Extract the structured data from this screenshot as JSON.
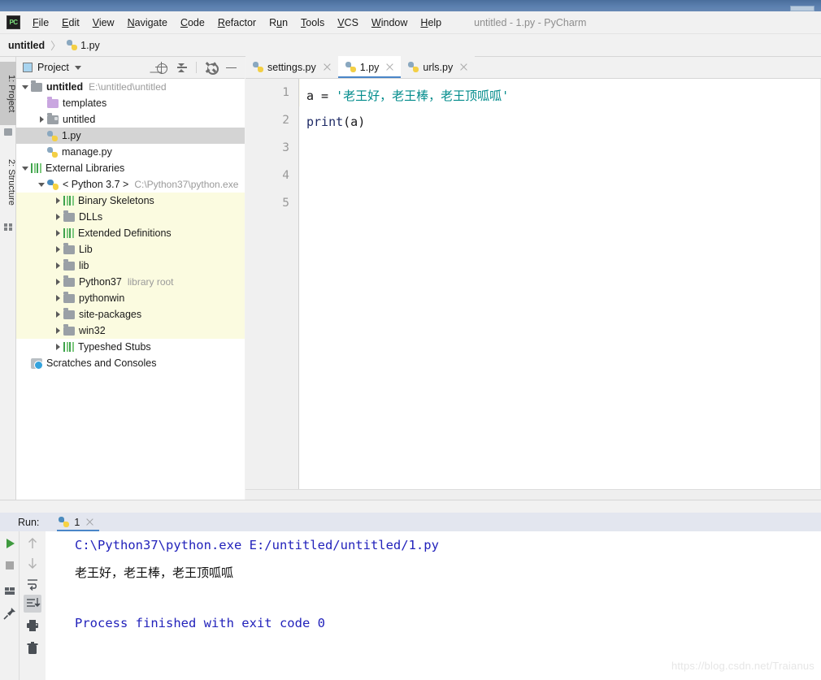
{
  "window": {
    "title": "untitled - 1.py - PyCharm",
    "minimize_icon": "window-minimize-icon"
  },
  "menubar": {
    "logo": "pycharm-logo-icon",
    "items": [
      {
        "label": "File",
        "mnemonic": "F"
      },
      {
        "label": "Edit",
        "mnemonic": "E"
      },
      {
        "label": "View",
        "mnemonic": "V"
      },
      {
        "label": "Navigate",
        "mnemonic": "N"
      },
      {
        "label": "Code",
        "mnemonic": "C"
      },
      {
        "label": "Refactor",
        "mnemonic": "R"
      },
      {
        "label": "Run",
        "mnemonic": "u"
      },
      {
        "label": "Tools",
        "mnemonic": "T"
      },
      {
        "label": "VCS",
        "mnemonic": "V"
      },
      {
        "label": "Window",
        "mnemonic": "W"
      },
      {
        "label": "Help",
        "mnemonic": "H"
      }
    ]
  },
  "breadcrumb": {
    "project": "untitled",
    "separator": "〉",
    "file": "1.py",
    "file_icon": "python-file-icon"
  },
  "tool_tabs": [
    {
      "label": "1: Project",
      "active": true,
      "icon": "project-icon"
    },
    {
      "label": "2: Structure",
      "active": false,
      "icon": "structure-icon"
    }
  ],
  "project_panel": {
    "title": "Project",
    "view_icon": "project-view-icon",
    "dropdown_icon": "chevron-down-icon",
    "toolbar": [
      {
        "name": "locate-in-tree-icon",
        "tooltip": "Select Opened File"
      },
      {
        "name": "collapse-all-icon",
        "tooltip": "Collapse All"
      },
      {
        "name": "gear-icon",
        "tooltip": "Settings"
      },
      {
        "name": "hide-icon",
        "tooltip": "Hide"
      }
    ],
    "tree": [
      {
        "label": "untitled",
        "path": "E:\\untitled\\untitled",
        "indent": 0,
        "arrow": "down",
        "icon": "folder",
        "bold": true,
        "state": "normal"
      },
      {
        "label": "templates",
        "path": "",
        "indent": 1,
        "arrow": "none",
        "icon": "folder-purple",
        "bold": false,
        "state": "normal"
      },
      {
        "label": "untitled",
        "path": "",
        "indent": 1,
        "arrow": "right",
        "icon": "folder-module",
        "bold": false,
        "state": "normal"
      },
      {
        "label": "1.py",
        "path": "",
        "indent": 1,
        "arrow": "none",
        "icon": "python-file-icon",
        "bold": false,
        "state": "selected"
      },
      {
        "label": "manage.py",
        "path": "",
        "indent": 1,
        "arrow": "none",
        "icon": "python-file-icon",
        "bold": false,
        "state": "normal"
      },
      {
        "label": "External Libraries",
        "path": "",
        "indent": 0,
        "arrow": "down",
        "icon": "library-icon",
        "bold": false,
        "state": "normal"
      },
      {
        "label": "< Python 3.7 >",
        "path": "C:\\Python37\\python.exe",
        "indent": 1,
        "arrow": "down",
        "icon": "python-sdk-icon",
        "bold": false,
        "state": "normal"
      },
      {
        "label": "Binary Skeletons",
        "path": "",
        "indent": 2,
        "arrow": "right",
        "icon": "library-icon",
        "bold": false,
        "state": "highlight"
      },
      {
        "label": "DLLs",
        "path": "",
        "indent": 2,
        "arrow": "right",
        "icon": "folder",
        "bold": false,
        "state": "highlight"
      },
      {
        "label": "Extended Definitions",
        "path": "",
        "indent": 2,
        "arrow": "right",
        "icon": "library-icon",
        "bold": false,
        "state": "highlight"
      },
      {
        "label": "Lib",
        "path": "",
        "indent": 2,
        "arrow": "right",
        "icon": "folder",
        "bold": false,
        "state": "highlight"
      },
      {
        "label": "lib",
        "path": "",
        "indent": 2,
        "arrow": "right",
        "icon": "folder",
        "bold": false,
        "state": "highlight"
      },
      {
        "label": "Python37",
        "path": "library root",
        "indent": 2,
        "arrow": "right",
        "icon": "folder",
        "bold": false,
        "state": "highlight"
      },
      {
        "label": "pythonwin",
        "path": "",
        "indent": 2,
        "arrow": "right",
        "icon": "folder",
        "bold": false,
        "state": "highlight"
      },
      {
        "label": "site-packages",
        "path": "",
        "indent": 2,
        "arrow": "right",
        "icon": "folder",
        "bold": false,
        "state": "highlight"
      },
      {
        "label": "win32",
        "path": "",
        "indent": 2,
        "arrow": "right",
        "icon": "folder",
        "bold": false,
        "state": "highlight"
      },
      {
        "label": "Typeshed Stubs",
        "path": "",
        "indent": 2,
        "arrow": "right",
        "icon": "library-icon",
        "bold": false,
        "state": "normal"
      },
      {
        "label": "Scratches and Consoles",
        "path": "",
        "indent": 0,
        "arrow": "none",
        "icon": "scratches-icon",
        "bold": false,
        "state": "normal"
      }
    ]
  },
  "editor": {
    "tabs": [
      {
        "label": "settings.py",
        "active": false,
        "icon": "python-file-icon",
        "close_icon": "close-icon"
      },
      {
        "label": "1.py",
        "active": true,
        "icon": "python-file-icon",
        "close_icon": "close-icon"
      },
      {
        "label": "urls.py",
        "active": false,
        "icon": "python-file-icon",
        "close_icon": "close-icon"
      }
    ],
    "line_numbers": [
      "1",
      "2",
      "3",
      "4",
      "5"
    ],
    "current_line": 5,
    "lines": [
      {
        "plain": "a = ",
        "string": "'老王好，老王棒，老王顶呱呱'",
        "fn": "",
        "tail": ""
      },
      {
        "plain": "",
        "string": "",
        "fn": "print",
        "tail": "(a)"
      }
    ],
    "code_text_1": "a = '老王好，老王棒，老王顶呱呱'",
    "code_text_2": "print(a)",
    "colors": {
      "string": "#038c8c",
      "function": "#1f2b66",
      "plain": "#17171a",
      "current_line_bg": "#fbfaef"
    }
  },
  "run_panel": {
    "label": "Run:",
    "tab": {
      "label": "1",
      "icon": "python-file-icon",
      "close_icon": "close-icon"
    },
    "left_toolbar": [
      {
        "name": "run-icon",
        "tooltip": "Rerun"
      },
      {
        "name": "stop-icon",
        "tooltip": "Stop"
      },
      {
        "name": "layout-icon",
        "tooltip": "Restore Layout"
      },
      {
        "name": "pin-icon",
        "tooltip": "Pin Tab"
      }
    ],
    "right_toolbar": [
      {
        "name": "arrow-up-icon",
        "tooltip": "Up the Stack Trace",
        "selected": false
      },
      {
        "name": "arrow-down-icon",
        "tooltip": "Down the Stack Trace",
        "selected": false
      },
      {
        "name": "soft-wrap-icon",
        "tooltip": "Use Soft Wraps",
        "selected": false
      },
      {
        "name": "scroll-to-end-icon",
        "tooltip": "Scroll to End",
        "selected": true
      },
      {
        "name": "print-icon",
        "tooltip": "Print",
        "selected": false
      },
      {
        "name": "trash-icon",
        "tooltip": "Clear All",
        "selected": false
      }
    ],
    "output": [
      {
        "text": "C:\\Python37\\python.exe E:/untitled/untitled/1.py",
        "kind": "command"
      },
      {
        "text": "老王好，老王棒，老王顶呱呱",
        "kind": "stdout"
      },
      {
        "text": "Process finished with exit code 0",
        "kind": "status"
      }
    ],
    "colors": {
      "command": "#2222bb",
      "stdout": "#111111",
      "status": "#2222bb"
    }
  },
  "watermark": "https://blog.csdn.net/Traianus"
}
